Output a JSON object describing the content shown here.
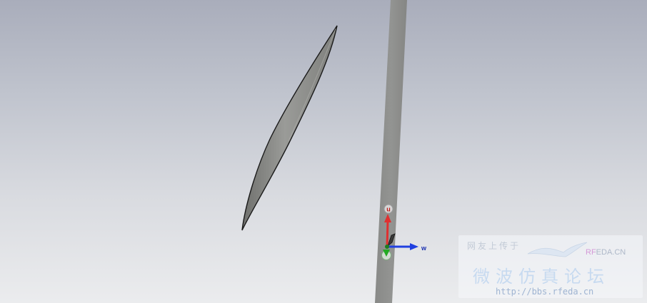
{
  "scene": {
    "background_top": "#a9adbb",
    "background_bottom": "#ebecee",
    "object_color": "#8c8c8a",
    "objects": [
      "lens-element",
      "strip-conductor"
    ]
  },
  "axes": {
    "u_label": "u",
    "w_label": "w",
    "u_color": "#e03030",
    "w_color": "#2040e0",
    "v_color": "#22aa22"
  },
  "watermark": {
    "line1": "网友上传于",
    "brand_prefix": "RF",
    "brand_rest": "EDA.CN",
    "title": "微波仿真论坛",
    "url": "http://bbs.rfeda.cn"
  }
}
